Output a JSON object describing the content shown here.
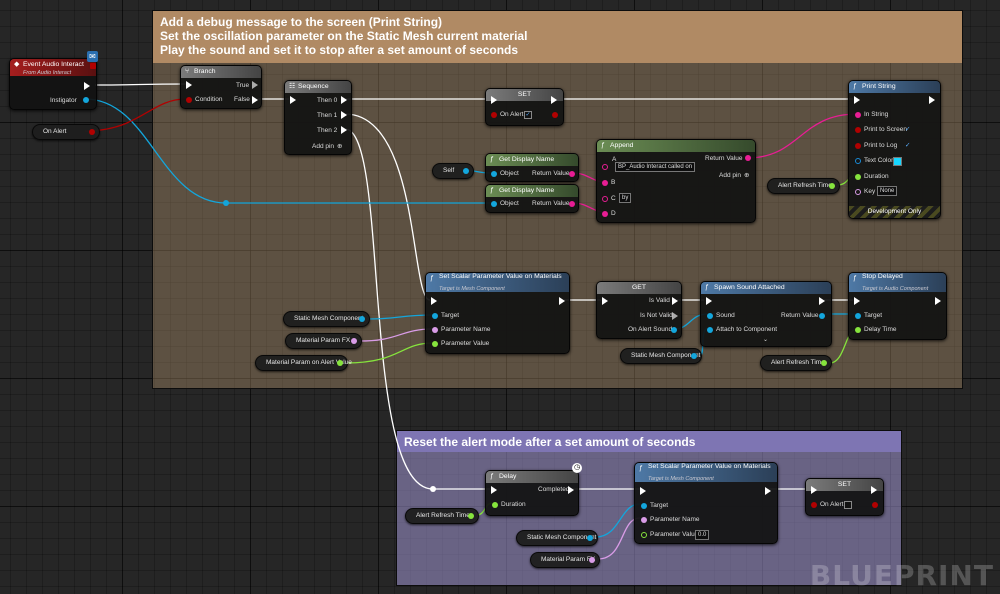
{
  "comments": {
    "top": [
      "Add a debug message to the screen (Print String)",
      "Set the oscillation parameter on the Static Mesh current material",
      "Play the sound and set it to stop after a set amount of seconds"
    ],
    "bottom": "Reset the alert mode after a set amount of seconds"
  },
  "nodes": {
    "event": {
      "title": "Event Audio Interact",
      "subtitle": "From Audio Interact",
      "pin_instigator": "Instigator"
    },
    "branch": {
      "title": "Branch",
      "pin_true": "True",
      "pin_false": "False",
      "pin_condition": "Condition"
    },
    "sequence": {
      "title": "Sequence",
      "then0": "Then 0",
      "then1": "Then 1",
      "then2": "Then 2",
      "add_pin": "Add pin"
    },
    "set1": {
      "title": "SET",
      "pin": "On Alert"
    },
    "print_string": {
      "title": "Print String",
      "in_string": "In String",
      "print_to_screen": "Print to Screen",
      "print_to_log": "Print to Log",
      "text_color": "Text Color",
      "duration": "Duration",
      "key": "Key",
      "key_value": "None",
      "dev_only": "Development Only"
    },
    "get_display_name_1": {
      "title": "Get Display Name",
      "object": "Object",
      "return_value": "Return Value"
    },
    "get_display_name_2": {
      "title": "Get Display Name",
      "object": "Object",
      "return_value": "Return Value"
    },
    "append": {
      "title": "Append",
      "a": "A",
      "a_value": "BP_Audio Interact called on",
      "b": "B",
      "c": "C",
      "c_value": "by",
      "d": "D",
      "return_value": "Return Value",
      "add_pin": "Add pin"
    },
    "set_scalar_1": {
      "title": "Set Scalar Parameter Value on Materials",
      "subtitle": "Target is Mesh Component",
      "target": "Target",
      "param_name": "Parameter Name",
      "param_value": "Parameter Value"
    },
    "get_node": {
      "title": "GET",
      "is_valid": "Is Valid",
      "is_not_valid": "Is Not Valid",
      "on_alert_sound": "On Alert Sound"
    },
    "spawn_sound": {
      "title": "Spawn Sound Attached",
      "sound": "Sound",
      "attach": "Attach to Component",
      "return_value": "Return Value"
    },
    "stop_delayed": {
      "title": "Stop Delayed",
      "subtitle": "Target is Audio Component",
      "target": "Target",
      "delay_time": "Delay Time"
    },
    "delay": {
      "title": "Delay",
      "completed": "Completed",
      "duration": "Duration"
    },
    "set_scalar_2": {
      "title": "Set Scalar Parameter Value on Materials",
      "subtitle": "Target is Mesh Component",
      "target": "Target",
      "param_name": "Parameter Name",
      "param_value": "Parameter Value",
      "param_value_input": "0.0"
    },
    "set2": {
      "title": "SET",
      "pin": "On Alert"
    }
  },
  "variables": {
    "on_alert": "On Alert",
    "self": "Self",
    "alert_refresh_time_1": "Alert Refresh Time",
    "static_mesh_1": "Static Mesh Component",
    "material_param_fx_1": "Material Param FX",
    "material_param_on_alert": "Material Param on Alert Value",
    "static_mesh_2": "Static Mesh Component",
    "alert_refresh_time_2": "Alert Refresh Time",
    "alert_refresh_time_3": "Alert Refresh Time",
    "static_mesh_3": "Static Mesh Component",
    "material_param_fx_2": "Material Param FX"
  },
  "watermark": "BLUEPRINT",
  "colors": {
    "exec": "#ffffff",
    "object": "#13a6dc",
    "string": "#e81d94",
    "float": "#86e43d",
    "bool": "#b10101",
    "name": "#d99ce7",
    "struct_color": "#16d6ff"
  }
}
